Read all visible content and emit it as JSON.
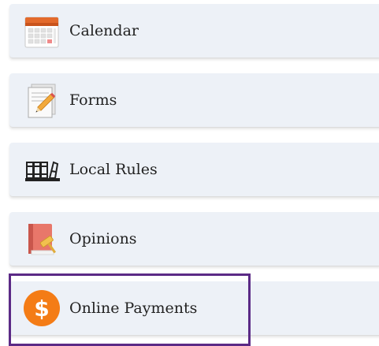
{
  "menu": {
    "items": [
      {
        "label": "Calendar",
        "icon": "calendar-icon"
      },
      {
        "label": "Forms",
        "icon": "form-pencil-icon"
      },
      {
        "label": "Local Rules",
        "icon": "law-books-icon"
      },
      {
        "label": "Opinions",
        "icon": "gavel-book-icon"
      },
      {
        "label": "Online Payments",
        "icon": "dollar-coin-icon"
      }
    ],
    "selected": "Online Payments"
  },
  "colors": {
    "item_background": "#edf1f7",
    "highlight_border": "#5b2a86",
    "payment_icon": "#f47c16"
  }
}
